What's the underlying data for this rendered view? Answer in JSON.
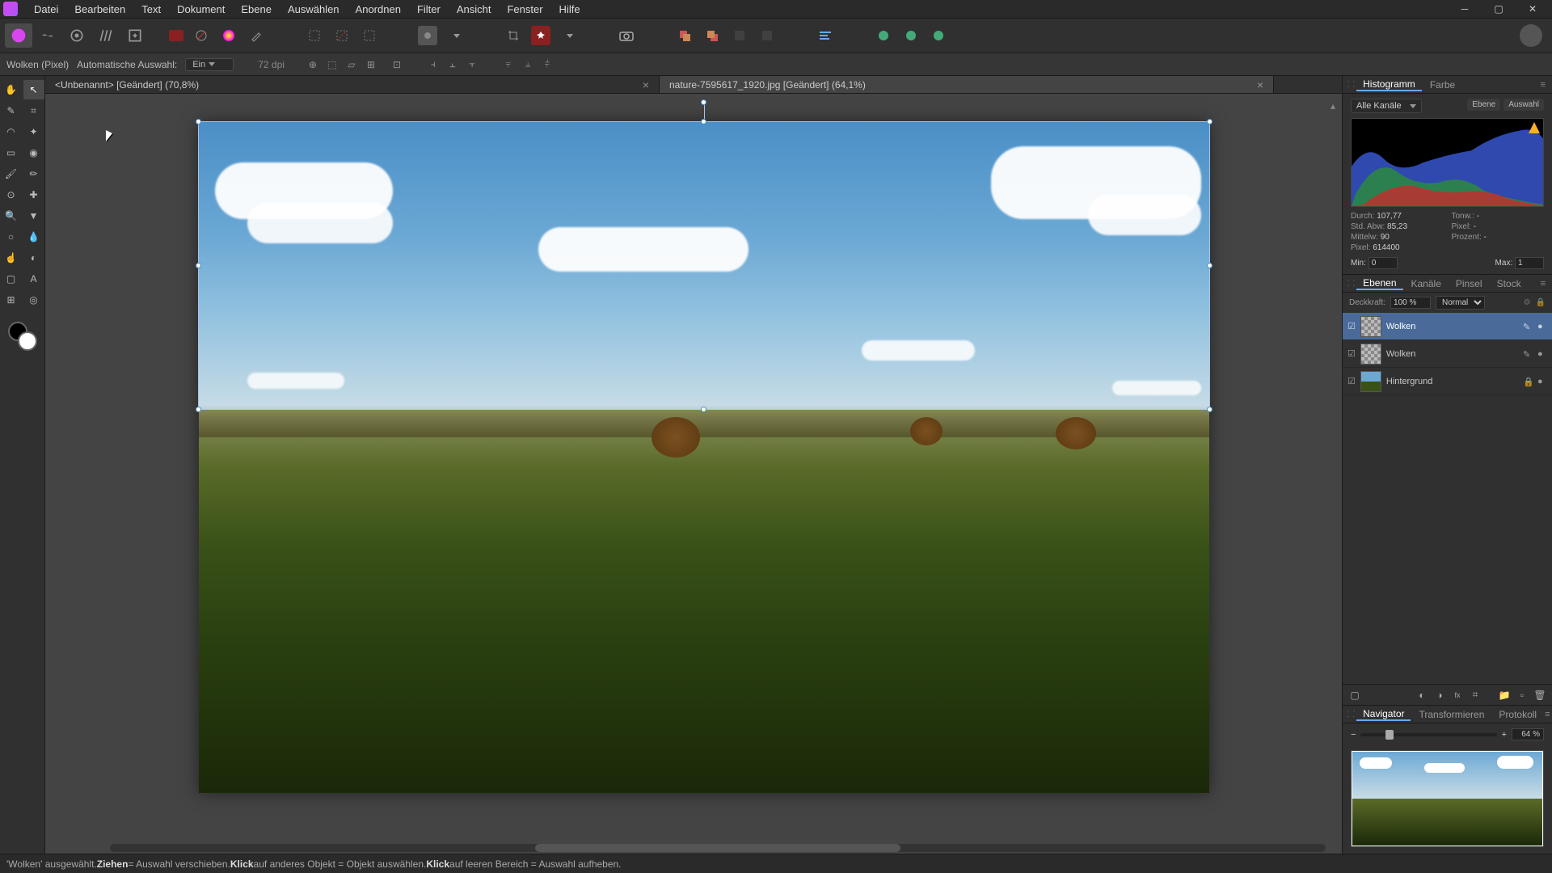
{
  "menu": {
    "items": [
      "Datei",
      "Bearbeiten",
      "Text",
      "Dokument",
      "Ebene",
      "Auswählen",
      "Anordnen",
      "Filter",
      "Ansicht",
      "Fenster",
      "Hilfe"
    ]
  },
  "context": {
    "tool_label": "Wolken (Pixel)",
    "auto_select_label": "Automatische Auswahl:",
    "auto_select_value": "Ein",
    "dpi": "72 dpi"
  },
  "tabs": [
    {
      "title": "<Unbenannt> [Geändert] (70,8%)",
      "active": false
    },
    {
      "title": "nature-7595617_1920.jpg [Geändert] (64,1%)",
      "active": true
    }
  ],
  "histogram": {
    "tab1": "Histogramm",
    "tab2": "Farbe",
    "channel": "Alle Kanäle",
    "btn_layer": "Ebene",
    "btn_sel": "Auswahl",
    "stats": {
      "durch_l": "Durch:",
      "durch_v": "107,77",
      "std_l": "Std. Abw:",
      "std_v": "85,23",
      "mittel_l": "Mittelw:",
      "mittel_v": "90",
      "pixel_l": "Pixel:",
      "pixel_v": "614400",
      "tonw_l": "Tonw.:",
      "tonw_v": "-",
      "pixr_l": "Pixel:",
      "pixr_v": "-",
      "proz_l": "Prozent:",
      "proz_v": "-"
    },
    "min_l": "Min:",
    "min_v": "0",
    "max_l": "Max:",
    "max_v": "1"
  },
  "layers_panel": {
    "tabs": [
      "Ebenen",
      "Kanäle",
      "Pinsel",
      "Stock"
    ],
    "opacity_l": "Deckkraft:",
    "opacity_v": "100 %",
    "blend": "Normal",
    "layers": [
      {
        "name": "Wolken",
        "selected": true,
        "thumb": "checker"
      },
      {
        "name": "Wolken",
        "selected": false,
        "thumb": "checker"
      },
      {
        "name": "Hintergrund",
        "selected": false,
        "thumb": "landscape",
        "locked": true
      }
    ]
  },
  "navigator": {
    "tabs": [
      "Navigator",
      "Transformieren",
      "Protokoll"
    ],
    "zoom": "64 %"
  },
  "status": {
    "prefix": "'Wolken' ausgewählt. ",
    "b1": "Ziehen",
    "t1": " = Auswahl verschieben. ",
    "b2": "Klick",
    "t2": " auf anderes Objekt = Objekt auswählen. ",
    "b3": "Klick",
    "t3": " auf leeren Bereich = Auswahl aufheben."
  }
}
